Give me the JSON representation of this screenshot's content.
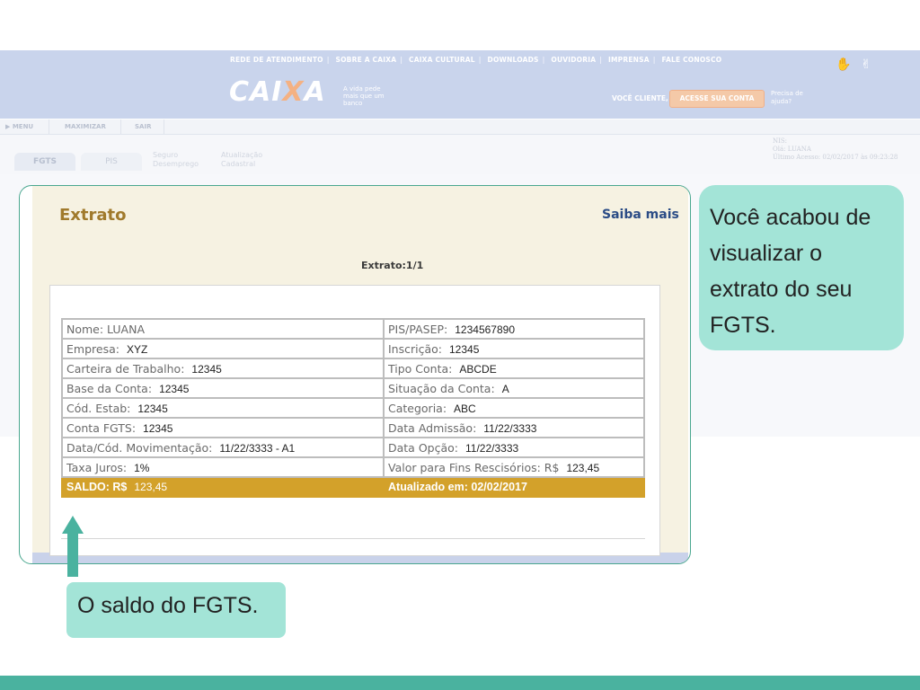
{
  "site": {
    "nav": [
      "REDE DE ATENDIMENTO",
      "SOBRE A CAIXA",
      "CAIXA CULTURAL",
      "DOWNLOADS",
      "OUVIDORIA",
      "IMPRENSA",
      "FALE CONOSCO"
    ],
    "logo_a": "CAI",
    "logo_x": "X",
    "logo_b": "A",
    "tagline": "A vida pede mais que um banco",
    "voce_cliente": "VOCÊ CLIENTE,",
    "acesse_label": "ACESSE SUA CONTA",
    "precisa_ajuda": "Precisa de ajuda?",
    "menu": [
      "▶ MENU",
      "MAXIMIZAR",
      "SAIR"
    ],
    "tabs": [
      "FGTS",
      "PIS",
      "Seguro Desemprego",
      "Atualização Cadastral"
    ],
    "session": {
      "nis": "NIS:",
      "ola": "Olá: LUANA",
      "ultimo": "Último Acesso: 02/02/2017 às 09:23:28"
    }
  },
  "extrato": {
    "title": "Extrato",
    "saiba_mais": "Saiba mais",
    "page": "Extrato:1/1",
    "rows": [
      {
        "l1": "Nome: LUANA",
        "v1": "",
        "l2": "PIS/PASEP:",
        "v2": "1234567890"
      },
      {
        "l1": "Empresa:",
        "v1": "XYZ",
        "l2": "Inscrição:",
        "v2": "12345"
      },
      {
        "l1": "Carteira de Trabalho:",
        "v1": "12345",
        "l2": "Tipo Conta:",
        "v2": "ABCDE"
      },
      {
        "l1": "Base da Conta:",
        "v1": "12345",
        "l2": "Situação da Conta:",
        "v2": "A"
      },
      {
        "l1": "Cód. Estab:",
        "v1": "12345",
        "l2": "Categoria:",
        "v2": "ABC"
      },
      {
        "l1": "Conta FGTS:",
        "v1": "12345",
        "l2": "Data Admissão:",
        "v2": "11/22/3333"
      },
      {
        "l1": "Data/Cód. Movimentação:",
        "v1": "11/22/3333 - A1",
        "l2": "Data Opção:",
        "v2": "11/22/3333"
      },
      {
        "l1": "Taxa Juros:",
        "v1": "1%",
        "l2": "Valor para Fins Rescisórios: R$",
        "v2": "123,45"
      }
    ],
    "saldo": {
      "l1": "SALDO: R$",
      "v1": "123,45",
      "l2": "Atualizado em: 02/02/2017",
      "v2": ""
    }
  },
  "callouts": {
    "right": "Você acabou de visualizar o extrato do seu FGTS.",
    "bottom": "O saldo do FGTS."
  },
  "colors": {
    "accent_teal": "#4ab29f",
    "callout_bg": "#a3e4d7",
    "saldo_gold": "#d3a12a",
    "title_brown": "#a07a2c",
    "header_blue": "#c9d4ec"
  }
}
